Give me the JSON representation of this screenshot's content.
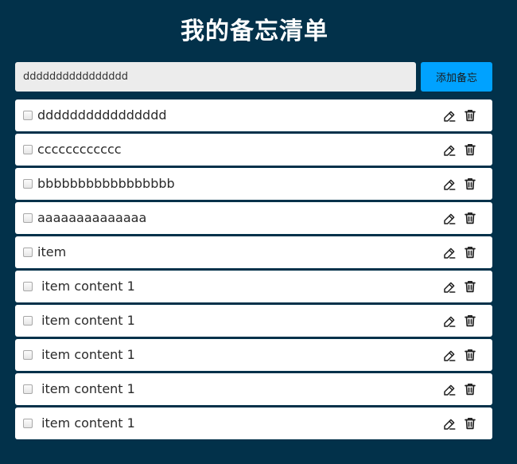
{
  "header": {
    "title": "我的备忘清单"
  },
  "add_form": {
    "input_value": "dddddddddddddddd",
    "button_label": "添加备忘"
  },
  "colors": {
    "background": "#02314a",
    "accent": "#00a2ff",
    "item_background": "#ffffff"
  },
  "items": [
    {
      "text": "dddddddddddddddd",
      "checked": false
    },
    {
      "text": "cccccccccccc",
      "checked": false
    },
    {
      "text": "bbbbbbbbbbbbbbbbb",
      "checked": false
    },
    {
      "text": "aaaaaaaaaaaaaa",
      "checked": false
    },
    {
      "text": "item",
      "checked": false
    },
    {
      "text": " item content 1",
      "checked": false
    },
    {
      "text": " item content 1",
      "checked": false
    },
    {
      "text": " item content 1",
      "checked": false
    },
    {
      "text": " item content 1",
      "checked": false
    },
    {
      "text": " item content 1",
      "checked": false
    }
  ],
  "icons": {
    "edit": "edit-icon",
    "delete": "trash-icon"
  }
}
